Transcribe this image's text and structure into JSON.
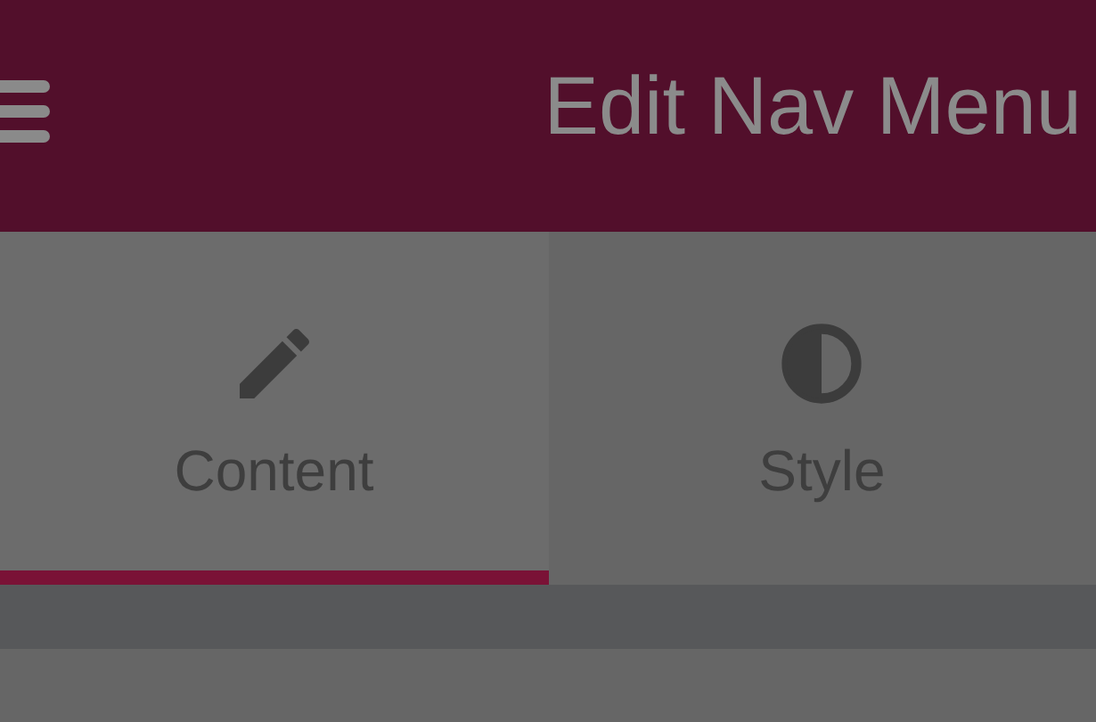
{
  "header": {
    "title": "Edit Nav Menu"
  },
  "tabs": [
    {
      "label": "Content",
      "kind": "pencil",
      "selected": true
    },
    {
      "label": "Style",
      "kind": "contrast",
      "selected": false
    }
  ]
}
